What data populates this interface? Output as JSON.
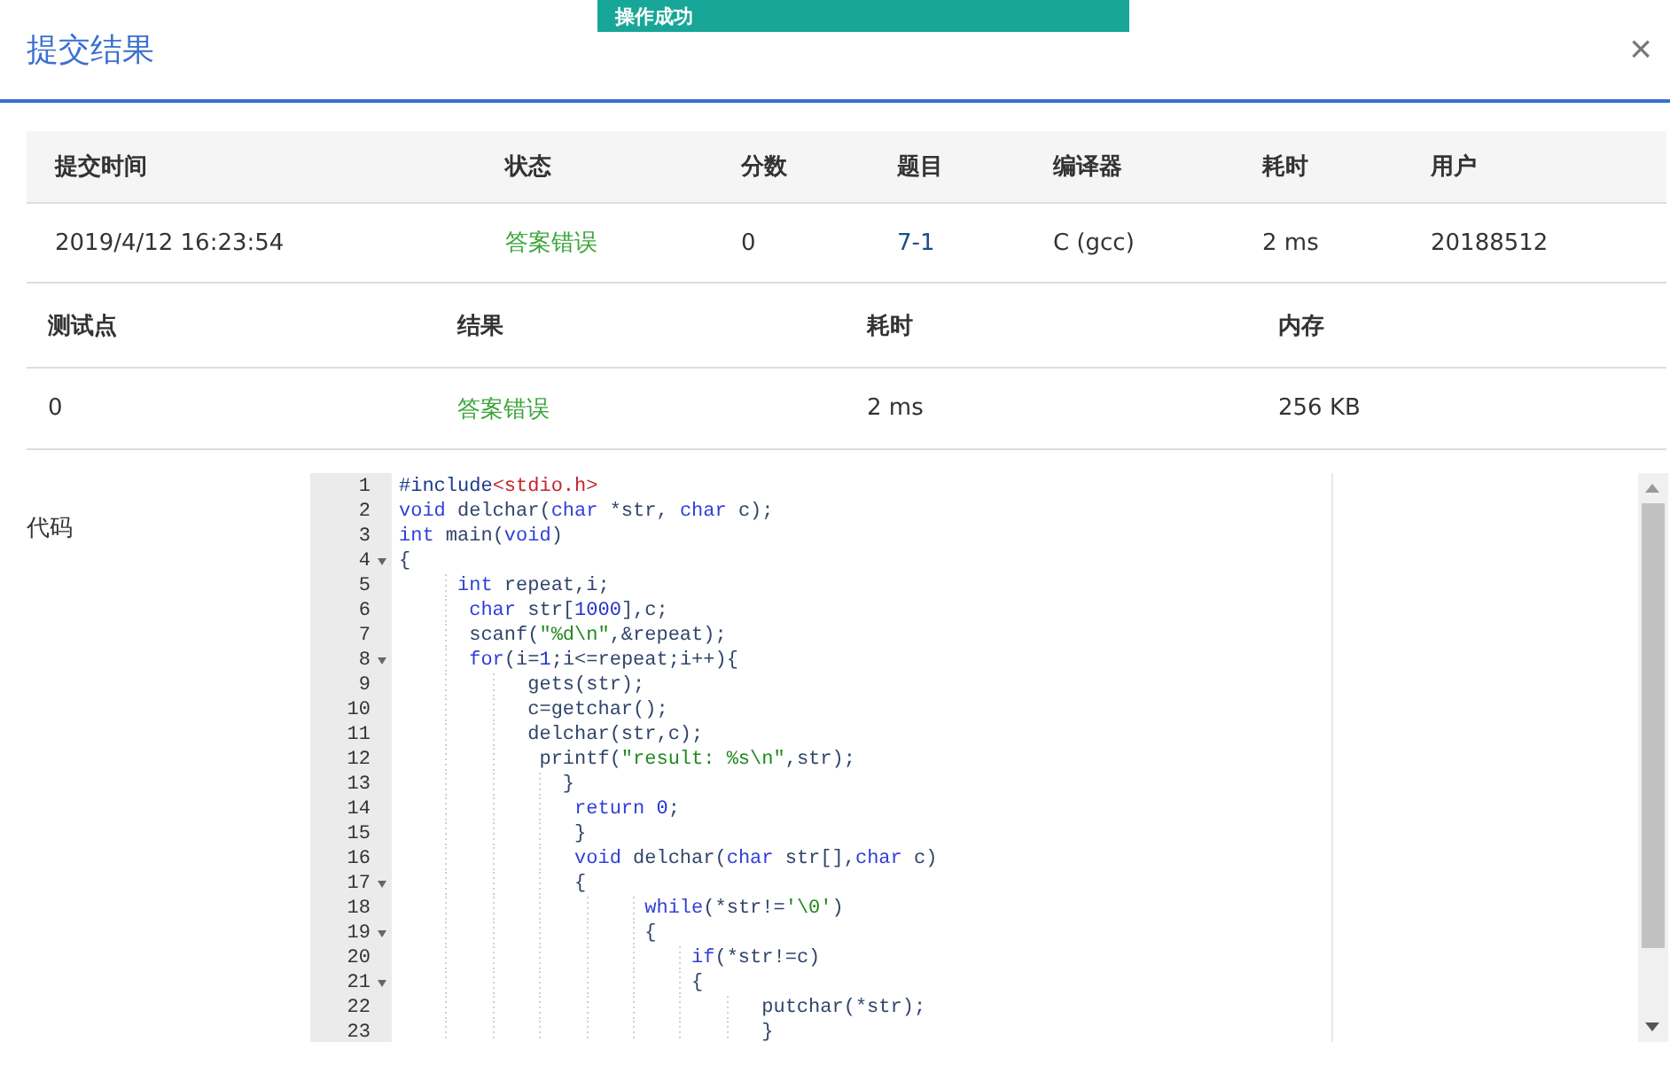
{
  "toast": {
    "text": "操作成功"
  },
  "dialog": {
    "title": "提交结果",
    "close": "×"
  },
  "submission_table": {
    "columns": [
      "提交时间",
      "状态",
      "分数",
      "题目",
      "编译器",
      "耗时",
      "用户"
    ],
    "rows": [
      [
        {
          "text": "2019/4/12 16:23:54",
          "kind": "plain"
        },
        {
          "text": "答案错误",
          "kind": "status"
        },
        {
          "text": "0",
          "kind": "plain"
        },
        {
          "text": "7-1",
          "kind": "link"
        },
        {
          "text": "C (gcc)",
          "kind": "plain"
        },
        {
          "text": "2 ms",
          "kind": "plain"
        },
        {
          "text": "20188512",
          "kind": "plain"
        }
      ]
    ]
  },
  "testcase_table": {
    "columns": [
      "测试点",
      "结果",
      "耗时",
      "内存"
    ],
    "rows": [
      [
        {
          "text": "0",
          "kind": "plain"
        },
        {
          "text": "答案错误",
          "kind": "status"
        },
        {
          "text": "2 ms",
          "kind": "plain"
        },
        {
          "text": "256 KB",
          "kind": "plain"
        }
      ]
    ]
  },
  "code": {
    "label": "代码",
    "lines": [
      {
        "number": "1",
        "fold": false,
        "tokens": [
          {
            "text": "#include",
            "kind": "meta"
          },
          {
            "text": "<stdio.h>",
            "kind": "header"
          }
        ]
      },
      {
        "number": "2",
        "fold": false,
        "tokens": [
          {
            "text": "void",
            "kind": "keyword"
          },
          {
            "text": " delchar(",
            "kind": "plain"
          },
          {
            "text": "char",
            "kind": "keyword"
          },
          {
            "text": " *str, ",
            "kind": "plain"
          },
          {
            "text": "char",
            "kind": "keyword"
          },
          {
            "text": " c);",
            "kind": "plain"
          }
        ]
      },
      {
        "number": "3",
        "fold": false,
        "tokens": [
          {
            "text": "int",
            "kind": "keyword"
          },
          {
            "text": " main(",
            "kind": "plain"
          },
          {
            "text": "void",
            "kind": "keyword"
          },
          {
            "text": ")",
            "kind": "plain"
          }
        ]
      },
      {
        "number": "4",
        "fold": true,
        "tokens": [
          {
            "text": "{",
            "kind": "plain"
          }
        ]
      },
      {
        "number": "5",
        "fold": false,
        "tokens": [
          {
            "text": "     int",
            "kind": "keyword"
          },
          {
            "text": " repeat,i;",
            "kind": "plain"
          }
        ]
      },
      {
        "number": "6",
        "fold": false,
        "tokens": [
          {
            "text": "      char",
            "kind": "keyword"
          },
          {
            "text": " str[",
            "kind": "plain"
          },
          {
            "text": "1000",
            "kind": "number"
          },
          {
            "text": "],c;",
            "kind": "plain"
          }
        ]
      },
      {
        "number": "7",
        "fold": false,
        "tokens": [
          {
            "text": "      scanf(",
            "kind": "plain"
          },
          {
            "text": "\"%d\\n\"",
            "kind": "string"
          },
          {
            "text": ",&repeat);",
            "kind": "plain"
          }
        ]
      },
      {
        "number": "8",
        "fold": true,
        "tokens": [
          {
            "text": "      for",
            "kind": "keyword"
          },
          {
            "text": "(i=",
            "kind": "plain"
          },
          {
            "text": "1",
            "kind": "number"
          },
          {
            "text": ";i<=repeat;i++){",
            "kind": "plain"
          }
        ]
      },
      {
        "number": "9",
        "fold": false,
        "tokens": [
          {
            "text": "           gets(str);",
            "kind": "plain"
          }
        ]
      },
      {
        "number": "10",
        "fold": false,
        "tokens": [
          {
            "text": "           c=getchar();",
            "kind": "plain"
          }
        ]
      },
      {
        "number": "11",
        "fold": false,
        "tokens": [
          {
            "text": "           delchar(str,c);",
            "kind": "plain"
          }
        ]
      },
      {
        "number": "12",
        "fold": false,
        "tokens": [
          {
            "text": "            printf(",
            "kind": "plain"
          },
          {
            "text": "\"result: %s\\n\"",
            "kind": "string"
          },
          {
            "text": ",str);",
            "kind": "plain"
          }
        ]
      },
      {
        "number": "13",
        "fold": false,
        "tokens": [
          {
            "text": "              }",
            "kind": "plain"
          }
        ]
      },
      {
        "number": "14",
        "fold": false,
        "tokens": [
          {
            "text": "               return ",
            "kind": "keyword"
          },
          {
            "text": "0",
            "kind": "number"
          },
          {
            "text": ";",
            "kind": "plain"
          }
        ]
      },
      {
        "number": "15",
        "fold": false,
        "tokens": [
          {
            "text": "               }",
            "kind": "plain"
          }
        ]
      },
      {
        "number": "16",
        "fold": false,
        "tokens": [
          {
            "text": "               void",
            "kind": "keyword"
          },
          {
            "text": " delchar(",
            "kind": "plain"
          },
          {
            "text": "char",
            "kind": "keyword"
          },
          {
            "text": " str[],",
            "kind": "plain"
          },
          {
            "text": "char",
            "kind": "keyword"
          },
          {
            "text": " c)",
            "kind": "plain"
          }
        ]
      },
      {
        "number": "17",
        "fold": true,
        "tokens": [
          {
            "text": "               {",
            "kind": "plain"
          }
        ]
      },
      {
        "number": "18",
        "fold": false,
        "tokens": [
          {
            "text": "                     while",
            "kind": "keyword"
          },
          {
            "text": "(*str!=",
            "kind": "plain"
          },
          {
            "text": "'\\0'",
            "kind": "string"
          },
          {
            "text": ")",
            "kind": "plain"
          }
        ]
      },
      {
        "number": "19",
        "fold": true,
        "tokens": [
          {
            "text": "                     {",
            "kind": "plain"
          }
        ]
      },
      {
        "number": "20",
        "fold": false,
        "tokens": [
          {
            "text": "                         if",
            "kind": "keyword"
          },
          {
            "text": "(*str!=c)",
            "kind": "plain"
          }
        ]
      },
      {
        "number": "21",
        "fold": true,
        "tokens": [
          {
            "text": "                         {",
            "kind": "plain"
          }
        ]
      },
      {
        "number": "22",
        "fold": false,
        "tokens": [
          {
            "text": "                               putchar(*str);",
            "kind": "plain"
          }
        ]
      },
      {
        "number": "23",
        "fold": false,
        "tokens": [
          {
            "text": "                               }",
            "kind": "plain"
          }
        ]
      }
    ]
  }
}
